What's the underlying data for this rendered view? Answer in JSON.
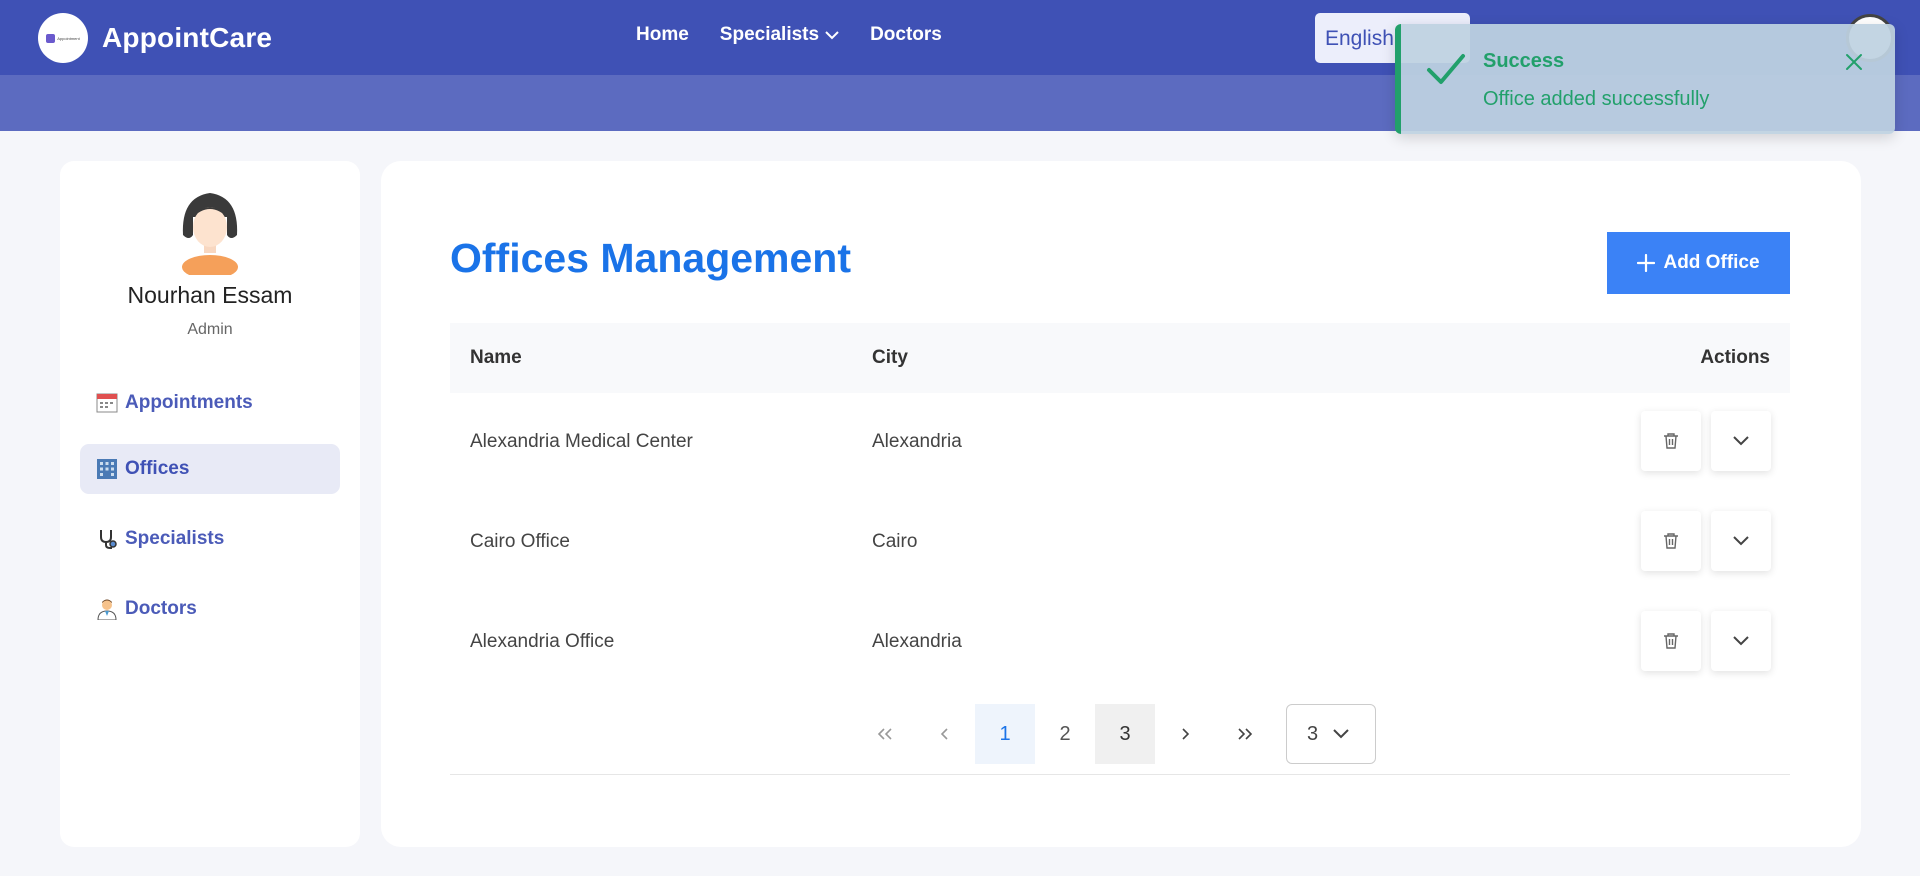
{
  "brand": {
    "name": "AppointCare",
    "logo_text": "Appointment"
  },
  "nav": {
    "links": [
      {
        "label": "Home"
      },
      {
        "label": "Specialists"
      },
      {
        "label": "Doctors"
      }
    ],
    "language": "English"
  },
  "toast": {
    "title": "Success",
    "message": "Office added successfully"
  },
  "profile": {
    "name": "Nourhan Essam",
    "role": "Admin"
  },
  "sidebar": {
    "items": [
      {
        "label": "Appointments",
        "icon": "calendar-icon"
      },
      {
        "label": "Offices",
        "icon": "office-building-icon",
        "active": true
      },
      {
        "label": "Specialists",
        "icon": "stethoscope-icon"
      },
      {
        "label": "Doctors",
        "icon": "doctor-icon"
      }
    ]
  },
  "main": {
    "title": "Offices Management",
    "add_button": "Add Office",
    "table": {
      "headers": {
        "name": "Name",
        "city": "City",
        "actions": "Actions"
      },
      "rows": [
        {
          "name": "Alexandria Medical Center",
          "city": "Alexandria"
        },
        {
          "name": "Cairo Office",
          "city": "Cairo"
        },
        {
          "name": "Alexandria Office",
          "city": "Alexandria"
        }
      ]
    },
    "pagination": {
      "pages": [
        "1",
        "2",
        "3"
      ],
      "current": "1",
      "page_size": "3"
    }
  },
  "colors": {
    "primary": "#3f51b5",
    "accent": "#1a73e8",
    "success": "#22a06b",
    "button": "#3b82f6"
  }
}
